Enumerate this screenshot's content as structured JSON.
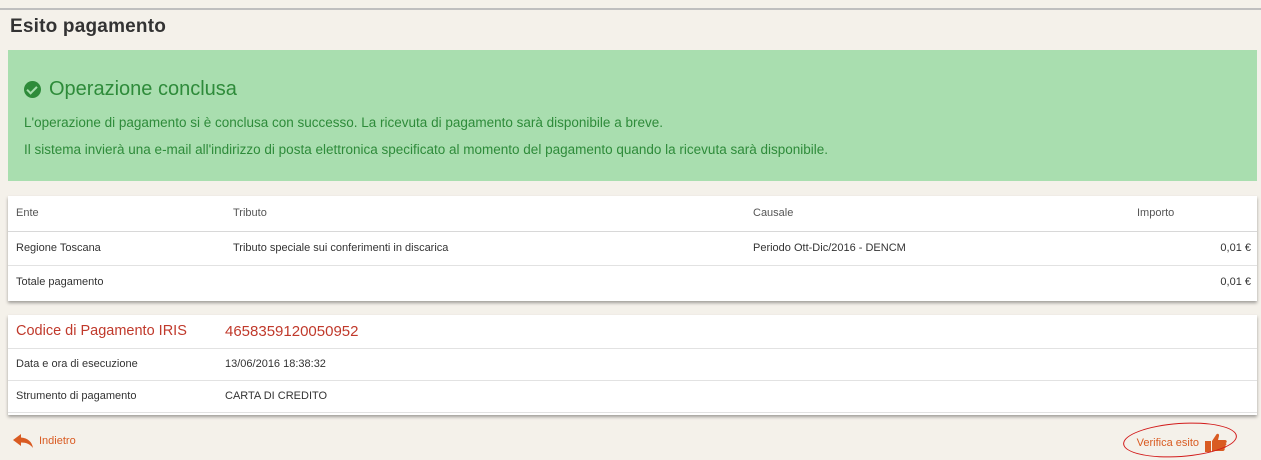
{
  "page": {
    "title": "Esito pagamento"
  },
  "alert": {
    "heading": "Operazione conclusa",
    "line1": "L'operazione di pagamento si è conclusa con successo. La ricevuta di pagamento sarà disponibile a breve.",
    "line2": "Il sistema invierà una e-mail all'indirizzo di posta elettronica specificato al momento del pagamento quando la ricevuta sarà disponibile.",
    "icon": "check-circle-icon",
    "color": "#2e8b3a",
    "background": "#a9deaf"
  },
  "payments": {
    "columns": [
      "Ente",
      "Tributo",
      "Causale",
      "Importo"
    ],
    "rows": [
      {
        "ente": "Regione Toscana",
        "tributo": "Tributo speciale sui conferimenti in discarica",
        "causale": "Periodo Ott-Dic/2016 - DENCM",
        "importo": "0,01 €"
      }
    ],
    "total_label": "Totale pagamento",
    "total_value": "0,01 €"
  },
  "payment_info": {
    "code_label": "Codice di Pagamento IRIS",
    "code_value": "4658359120050952",
    "execution_label": "Data e ora di esecuzione",
    "execution_value": "13/06/2016 18:38:32",
    "instrument_label": "Strumento di pagamento",
    "instrument_value": "CARTA DI CREDITO"
  },
  "footer": {
    "back_label": "Indietro",
    "back_icon": "reply-arrow-icon",
    "verify_label": "Verifica esito",
    "verify_icon": "pointing-hand-icon",
    "accent_color": "#d95b22",
    "annotation_color": "#d21b1b"
  }
}
